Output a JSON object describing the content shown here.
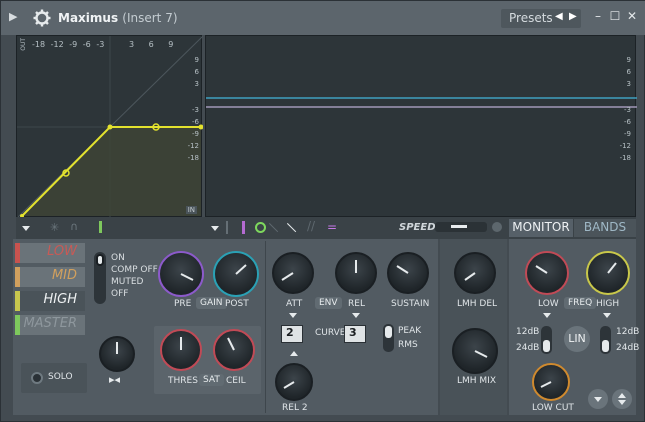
{
  "title": {
    "name": "Maximus",
    "sub": "(Insert 7)",
    "presets": "Presets"
  },
  "graph": {
    "io_top_label": "OUT",
    "io_bottom_label": "IN",
    "left_top_ticks": [
      "-18",
      "-12",
      "-9",
      "-6",
      "-3",
      "3",
      "6",
      "9"
    ],
    "left_side_ticks": [
      "9",
      "6",
      "3",
      "-3",
      "-6",
      "-9",
      "-12",
      "-18"
    ],
    "right_side_ticks": [
      "9",
      "6",
      "3",
      "-3",
      "-6",
      "-9",
      "-12",
      "-18"
    ]
  },
  "toolbar": {
    "speed": "SPEED",
    "monitor_tab": "MONITOR",
    "bands_tab": "BANDS"
  },
  "bands": [
    "LOW",
    "MID",
    "HIGH",
    "MASTER"
  ],
  "band_colors": [
    "#c8534f",
    "#d1a05e",
    "#c7c64d",
    "#7ec85d"
  ],
  "states": [
    "ON",
    "COMP OFF",
    "MUTED",
    "OFF"
  ],
  "solo": "SOLO",
  "labels": {
    "pre": "PRE",
    "gain": "GAIN",
    "post": "POST",
    "att": "ATT",
    "env": "ENV",
    "rel": "REL",
    "sustain": "SUSTAIN",
    "thres": "THRES",
    "sat": "SAT",
    "ceil": "CEIL",
    "curve": "CURVE",
    "curve1": "2",
    "curve2": "3",
    "peak": "PEAK",
    "rms": "RMS",
    "rel2": "REL 2",
    "lmh_del": "LMH DEL",
    "lmh_mix": "LMH MIX",
    "low": "LOW",
    "freq": "FREQ",
    "high": "HIGH",
    "db12a": "12dB",
    "db24a": "24dB",
    "db12b": "12dB",
    "db24b": "24dB",
    "lin": "LIN",
    "low_cut": "LOW CUT"
  }
}
